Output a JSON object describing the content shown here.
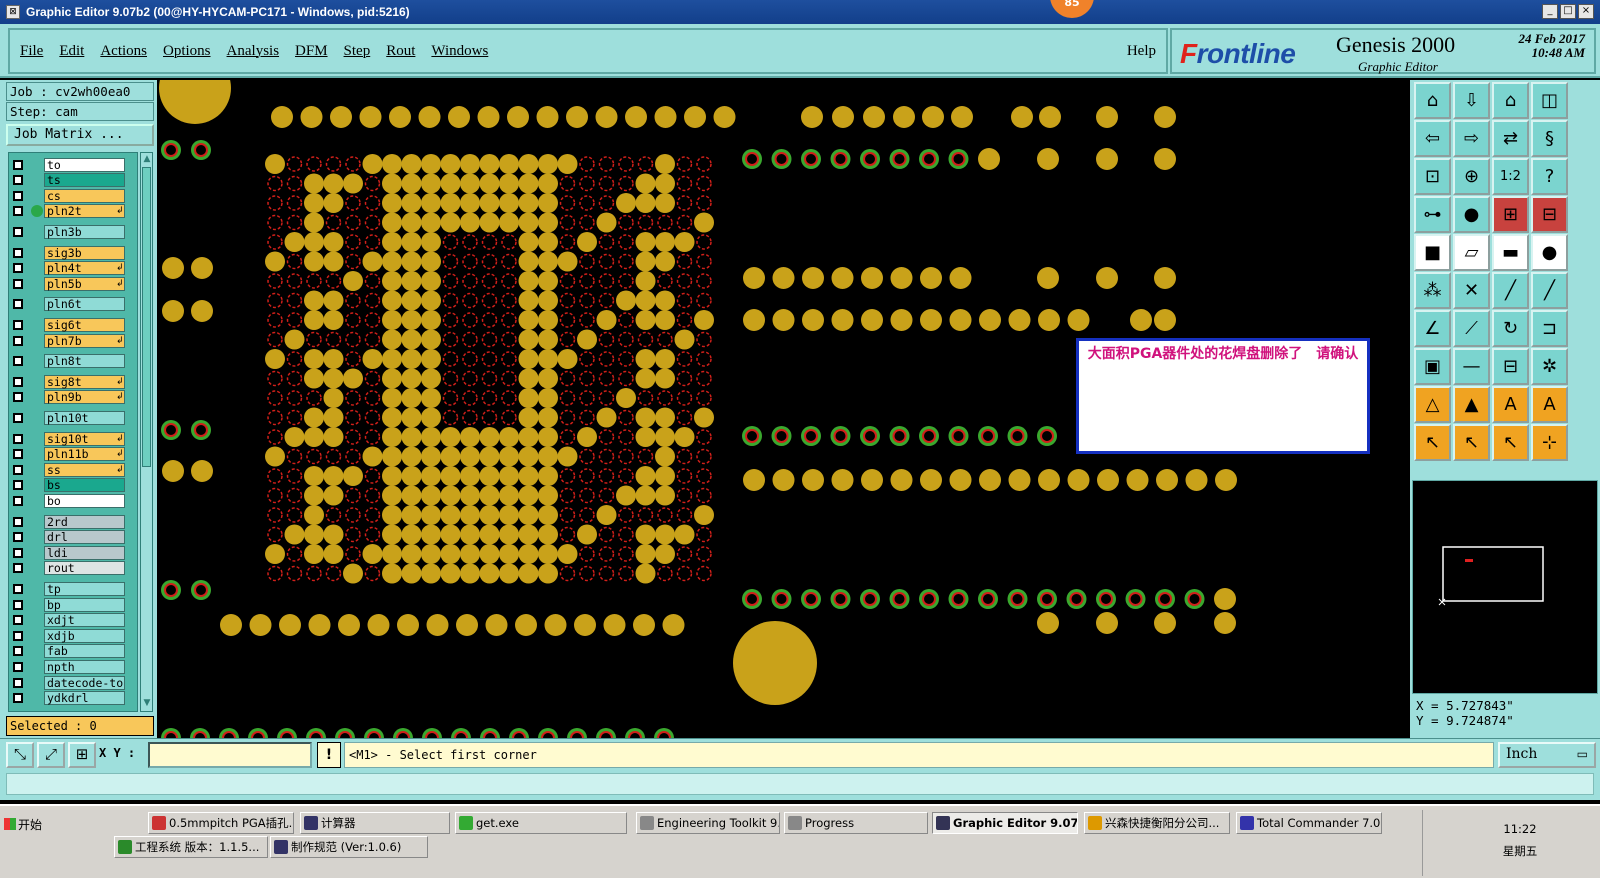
{
  "window": {
    "title": "Graphic Editor 9.07b2 (00@HY-HYCAM-PC171 - Windows, pid:5216)",
    "badge": "85",
    "controls": [
      "_",
      "□",
      "×"
    ]
  },
  "menu": {
    "items": [
      "File",
      "Edit",
      "Actions",
      "Options",
      "Analysis",
      "DFM",
      "Step",
      "Rout",
      "Windows"
    ],
    "help": "Help"
  },
  "brand": {
    "logo_first": "F",
    "logo_rest": "rontline",
    "product": "Genesis 2000",
    "subtitle": "Graphic Editor",
    "date": "24 Feb 2017",
    "time": "10:48 AM"
  },
  "job": {
    "job_line": "Job : cv2wh00ea0",
    "step_line": "Step: cam",
    "matrix_button": "Job Matrix ...",
    "selected": "Selected : 0"
  },
  "layers": [
    {
      "name": "to",
      "color": "#ffffff"
    },
    {
      "name": "ts",
      "color": "#1aa88e"
    },
    {
      "name": "cs",
      "color": "#f8c75a"
    },
    {
      "name": "pln2t",
      "color": "#f8c75a",
      "flag": true,
      "active": true
    },
    {
      "name": "pln3b",
      "color": "#8fdbd6"
    },
    {
      "name": "sig3b",
      "color": "#f8c75a"
    },
    {
      "name": "pln4t",
      "color": "#f8c75a",
      "flag": true
    },
    {
      "name": "pln5b",
      "color": "#f8c75a",
      "flag": true
    },
    {
      "name": "pln6t",
      "color": "#8fdbd6"
    },
    {
      "name": "sig6t",
      "color": "#f8c75a"
    },
    {
      "name": "pln7b",
      "color": "#f8c75a",
      "flag": true
    },
    {
      "name": "pln8t",
      "color": "#8fdbd6"
    },
    {
      "name": "sig8t",
      "color": "#f8c75a",
      "flag": true
    },
    {
      "name": "pln9b",
      "color": "#f8c75a",
      "flag": true
    },
    {
      "name": "pln10t",
      "color": "#8fdbd6"
    },
    {
      "name": "sig10t",
      "color": "#f8c75a",
      "flag": true
    },
    {
      "name": "pln11b",
      "color": "#f8c75a",
      "flag": true
    },
    {
      "name": "ss",
      "color": "#f8c75a",
      "flag": true
    },
    {
      "name": "bs",
      "color": "#1aa88e"
    },
    {
      "name": "bo",
      "color": "#ffffff"
    },
    {
      "name": "2rd",
      "color": "#b8c8cc"
    },
    {
      "name": "drl",
      "color": "#b8c8cc"
    },
    {
      "name": "ldi",
      "color": "#b8c8cc"
    },
    {
      "name": "rout",
      "color": "#dde4e4"
    },
    {
      "name": "tp",
      "color": "#8fdbd6"
    },
    {
      "name": "bp",
      "color": "#8fdbd6"
    },
    {
      "name": "xdjt",
      "color": "#8fdbd6"
    },
    {
      "name": "xdjb",
      "color": "#8fdbd6"
    },
    {
      "name": "fab",
      "color": "#8fdbd6"
    },
    {
      "name": "npth",
      "color": "#8fdbd6"
    },
    {
      "name": "datecode-to",
      "color": "#8fdbd6"
    },
    {
      "name": "ydkdrl",
      "color": "#8fdbd6"
    }
  ],
  "note": {
    "text": "大面积PGA器件处的花焊盘删除了　请确认"
  },
  "coords": {
    "x": "X = 5.727843\"",
    "y": "Y = 9.724874\""
  },
  "command": {
    "xy_label": "X Y :",
    "xy_value": "",
    "warn": "!",
    "prompt": "<M1> - Select first corner",
    "units": "Inch"
  },
  "taskbar": {
    "start": "开始",
    "row1": [
      "0.5mmpitch PGA插孔...",
      "计算器",
      "get.exe",
      "Engineering Toolkit 9.0...",
      "Progress",
      "Graphic Editor 9.07b...",
      "兴森快捷衡阳分公司...",
      "Total Commander 7.0 p..."
    ],
    "row2": [
      "工程系统  版本：1.1.5...",
      "制作规范 (Ver:1.0.6)"
    ],
    "time": "11:22",
    "day": "星期五"
  },
  "colors": {
    "pad": "#c9a21a",
    "thermal_green": "#3aa82e",
    "thermal_red": "#d0201a",
    "panel": "#9edfdc"
  }
}
